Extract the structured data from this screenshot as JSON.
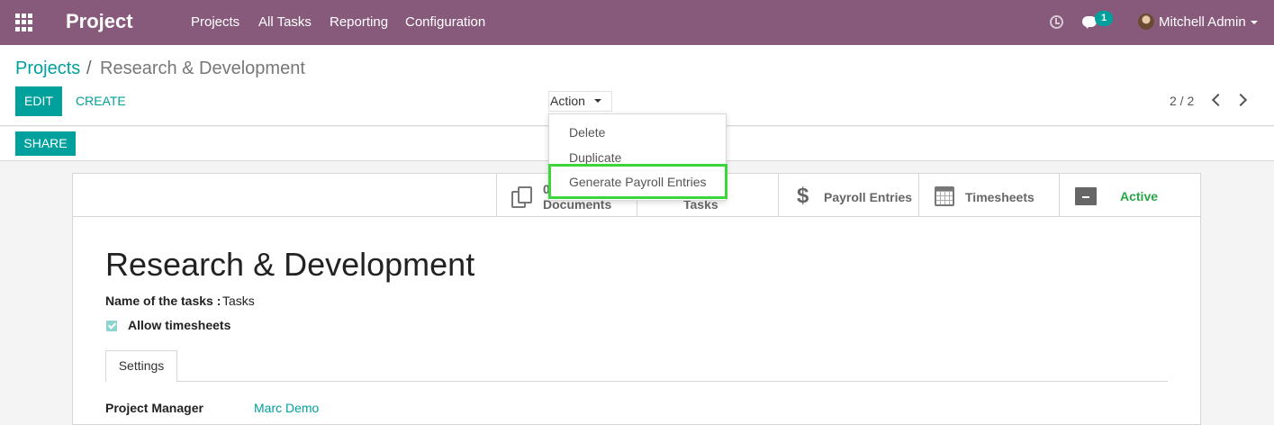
{
  "navbar": {
    "app_name": "Project",
    "menu": [
      "Projects",
      "All Tasks",
      "Reporting",
      "Configuration"
    ],
    "chat_badge": "1",
    "user_name": "Mitchell Admin"
  },
  "breadcrumb": {
    "parent": "Projects",
    "separator": "/",
    "current": "Research & Development"
  },
  "toolbar": {
    "edit_label": "EDIT",
    "create_label": "CREATE",
    "action_label": "Action",
    "pager": "2 / 2",
    "share_label": "SHARE"
  },
  "action_menu": [
    "Delete",
    "Duplicate",
    "Generate Payroll Entries"
  ],
  "stat_buttons": {
    "documents_count": "0",
    "documents_label": "Documents",
    "tasks_label": "Tasks",
    "payroll_label": "Payroll Entries",
    "timesheets_label": "Timesheets",
    "active_label": "Active"
  },
  "form": {
    "title": "Research & Development",
    "tasks_name_label": "Name of the tasks :",
    "tasks_name_value": "Tasks",
    "allow_timesheets_label": "Allow timesheets",
    "tab_settings": "Settings",
    "project_manager_label": "Project Manager",
    "project_manager_value": "Marc Demo"
  },
  "colors": {
    "navbar": "#875a7b",
    "primary": "#00a09d",
    "active": "#28a745",
    "highlight": "#3bd63b"
  }
}
